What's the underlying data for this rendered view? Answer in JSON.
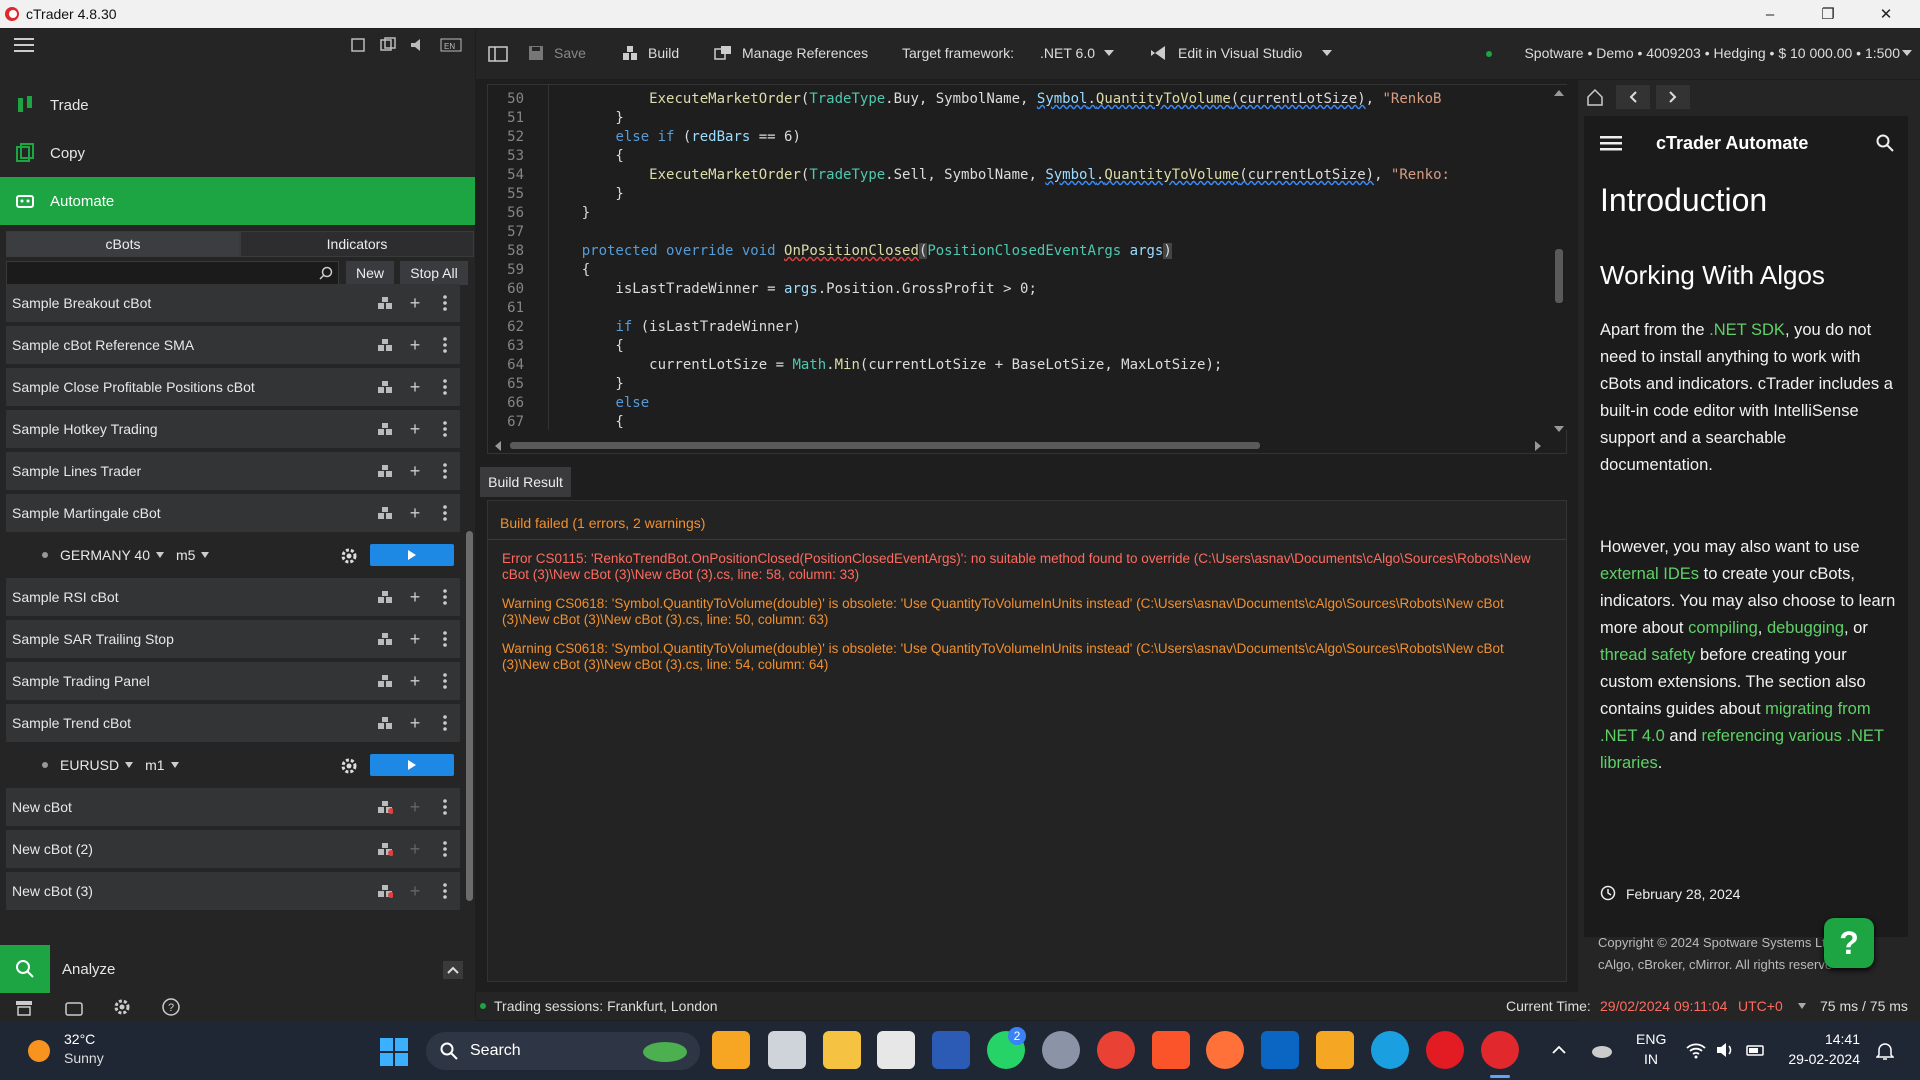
{
  "window": {
    "title": "cTrader 4.8.30"
  },
  "nav": {
    "trade": "Trade",
    "copy": "Copy",
    "automate": "Automate",
    "analyze": "Analyze"
  },
  "tabs": {
    "cbots": "cBots",
    "indicators": "Indicators"
  },
  "search": {
    "placeholder": "",
    "new_label": "New",
    "stop_all_label": "Stop All"
  },
  "cbots": [
    "Sample Breakout cBot",
    "Sample cBot Reference SMA",
    "Sample Close Profitable Positions cBot",
    "Sample Hotkey Trading",
    "Sample Lines Trader",
    "Sample Martingale cBot",
    "Sample RSI cBot",
    "Sample SAR Trailing Stop",
    "Sample Trading Panel",
    "Sample Trend cBot",
    "New cBot",
    "New cBot (2)",
    "New cBot (3)"
  ],
  "instances": [
    {
      "symbol": "GERMANY 40",
      "timeframe": "m5"
    },
    {
      "symbol": "EURUSD",
      "timeframe": "m1"
    }
  ],
  "toolbar": {
    "save": "Save",
    "build": "Build",
    "manage_refs": "Manage References",
    "target_label": "Target framework:",
    "target_value": ".NET 6.0",
    "edit_vs": "Edit in Visual Studio",
    "account": "Spotware • Demo • 4009203 • Hedging • $ 10 000.00 • 1:500"
  },
  "editor": {
    "line_numbers": [
      "50",
      "51",
      "52",
      "53",
      "54",
      "55",
      "56",
      "57",
      "58",
      "59",
      "60",
      "61",
      "62",
      "63",
      "64",
      "65",
      "66",
      "67"
    ]
  },
  "build": {
    "tab": "Build Result",
    "summary": "Build failed (1 errors, 2 warnings)",
    "messages": [
      "Error CS0115: 'RenkoTrendBot.OnPositionClosed(PositionClosedEventArgs)': no suitable method found to override (C:\\Users\\asnav\\Documents\\cAlgo\\Sources\\Robots\\New cBot (3)\\New cBot (3)\\New cBot (3).cs, line: 58, column: 33)",
      "Warning CS0618: 'Symbol.QuantityToVolume(double)' is obsolete: 'Use QuantityToVolumeInUnits instead' (C:\\Users\\asnav\\Documents\\cAlgo\\Sources\\Robots\\New cBot (3)\\New cBot (3)\\New cBot (3).cs, line: 50, column: 63)",
      "Warning CS0618: 'Symbol.QuantityToVolume(double)' is obsolete: 'Use QuantityToVolumeInUnits instead' (C:\\Users\\asnav\\Documents\\cAlgo\\Sources\\Robots\\New cBot (3)\\New cBot (3)\\New cBot (3).cs, line: 54, column: 64)"
    ]
  },
  "help": {
    "app_title": "cTrader Automate",
    "h1": "Introduction",
    "h2": "Working With Algos",
    "date": "February 28, 2024",
    "footer1": "Copyright © 2024 Spotware Systems Lt",
    "footer2": "cAlgo, cBroker, cMirror. All rights reserve",
    "help_badge": "?"
  },
  "status": {
    "sessions": "Trading sessions: Frankfurt, London",
    "time_label": "Current Time:",
    "time_value": "29/02/2024 09:11:04",
    "tz": "UTC+0",
    "latency": "75 ms / 75 ms"
  },
  "taskbar": {
    "temp": "32°C",
    "weather": "Sunny",
    "search": "Search",
    "lang1": "ENG",
    "lang2": "IN",
    "time": "14:41",
    "date": "29-02-2024",
    "whatsapp_badge": "2"
  },
  "colors": {
    "accent": "#1ea543",
    "link": "#5fd068",
    "error": "#ff6b5e",
    "warning": "#f0902e",
    "play": "#1e88e5"
  }
}
